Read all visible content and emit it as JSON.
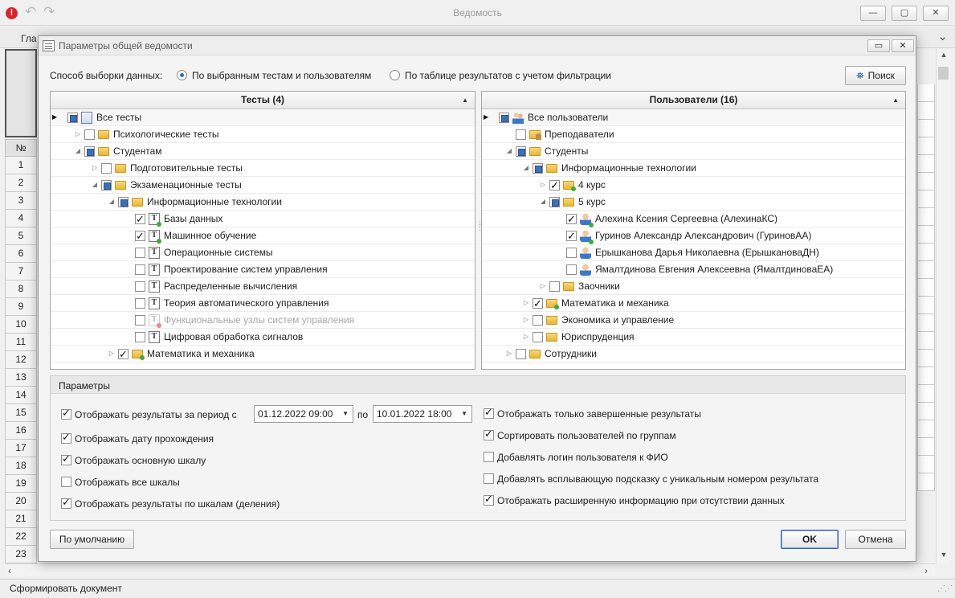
{
  "main": {
    "title": "Ведомость",
    "menu_tab": "Гла",
    "status": "Сформировать документ",
    "grid_header": "№",
    "row_numbers": [
      "1",
      "2",
      "3",
      "4",
      "5",
      "6",
      "7",
      "8",
      "9",
      "10",
      "11",
      "12",
      "13",
      "14",
      "15",
      "16",
      "17",
      "18",
      "19",
      "20",
      "21",
      "22",
      "23"
    ]
  },
  "dialog": {
    "title": "Параметры общей ведомости",
    "selection_label": "Способ выборки данных:",
    "radio_selected": "По выбранным тестам и пользователям",
    "radio_other": "По таблице результатов с учетом фильтрации",
    "search_button": "Поиск",
    "default_button": "По умолчанию",
    "ok_button": "OK",
    "cancel_button": "Отмена"
  },
  "tests": {
    "header": "Тесты (4)",
    "rows": [
      {
        "label": "Все тесты",
        "level": 0,
        "exp": "",
        "cb": "partial",
        "icon": "doc",
        "marker": true
      },
      {
        "label": "Психологические тесты",
        "level": 1,
        "exp": "collapsed",
        "cb": "unchecked",
        "icon": "folder"
      },
      {
        "label": "Студентам",
        "level": 1,
        "exp": "expanded",
        "cb": "partial",
        "icon": "folder"
      },
      {
        "label": "Подготовительные тесты",
        "level": 2,
        "exp": "collapsed",
        "cb": "unchecked",
        "icon": "folder"
      },
      {
        "label": "Экзаменационные тесты",
        "level": 2,
        "exp": "expanded",
        "cb": "partial",
        "icon": "folder"
      },
      {
        "label": "Информационные технологии",
        "level": 3,
        "exp": "expanded",
        "cb": "partial",
        "icon": "folder"
      },
      {
        "label": "Базы данных",
        "level": 4,
        "exp": "",
        "cb": "checked",
        "icon": "test-green"
      },
      {
        "label": "Машинное обучение",
        "level": 4,
        "exp": "",
        "cb": "checked",
        "icon": "test-green"
      },
      {
        "label": "Операционные системы",
        "level": 4,
        "exp": "",
        "cb": "unchecked",
        "icon": "test"
      },
      {
        "label": "Проектирование систем управления",
        "level": 4,
        "exp": "",
        "cb": "unchecked",
        "icon": "test"
      },
      {
        "label": "Распределенные вычисления",
        "level": 4,
        "exp": "",
        "cb": "unchecked",
        "icon": "test"
      },
      {
        "label": "Теория автоматического управления",
        "level": 4,
        "exp": "",
        "cb": "unchecked",
        "icon": "test"
      },
      {
        "label": "Функциональные узлы систем управления",
        "level": 4,
        "exp": "",
        "cb": "unchecked",
        "icon": "test-disabled",
        "disabled": true
      },
      {
        "label": "Цифровая обработка сигналов",
        "level": 4,
        "exp": "",
        "cb": "unchecked",
        "icon": "test"
      },
      {
        "label": "Математика и механика",
        "level": 3,
        "exp": "collapsed",
        "cb": "checked",
        "icon": "folder-green"
      }
    ]
  },
  "users": {
    "header": "Пользователи (16)",
    "rows": [
      {
        "label": "Все пользователи",
        "level": 0,
        "exp": "",
        "cb": "partial",
        "icon": "users",
        "marker": true
      },
      {
        "label": "Преподаватели",
        "level": 1,
        "exp": "",
        "cb": "unchecked",
        "icon": "teacher"
      },
      {
        "label": "Студенты",
        "level": 1,
        "exp": "expanded",
        "cb": "partial",
        "icon": "folder"
      },
      {
        "label": "Информационные технологии",
        "level": 2,
        "exp": "expanded",
        "cb": "partial",
        "icon": "folder"
      },
      {
        "label": "4 курс",
        "level": 3,
        "exp": "collapsed",
        "cb": "checked",
        "icon": "folder-green"
      },
      {
        "label": "5 курс",
        "level": 3,
        "exp": "expanded",
        "cb": "partial",
        "icon": "folder"
      },
      {
        "label": "Алехина Ксения Сергеевна (АлехинаКС)",
        "level": 4,
        "exp": "",
        "cb": "checked",
        "icon": "user-green"
      },
      {
        "label": "Гуринов Александр Александрович (ГуриновАА)",
        "level": 4,
        "exp": "",
        "cb": "checked",
        "icon": "user-green"
      },
      {
        "label": "Ерышканова Дарья Николаевна (ЕрышкановаДН)",
        "level": 4,
        "exp": "",
        "cb": "unchecked",
        "icon": "user"
      },
      {
        "label": "Ямалтдинова Евгения Алексеевна (ЯмалтдиноваЕА)",
        "level": 4,
        "exp": "",
        "cb": "unchecked",
        "icon": "user"
      },
      {
        "label": "Заочники",
        "level": 3,
        "exp": "collapsed",
        "cb": "unchecked",
        "icon": "folder"
      },
      {
        "label": "Математика и механика",
        "level": 2,
        "exp": "collapsed",
        "cb": "checked",
        "icon": "folder-green"
      },
      {
        "label": "Экономика и управление",
        "level": 2,
        "exp": "collapsed",
        "cb": "unchecked",
        "icon": "folder"
      },
      {
        "label": "Юриспруденция",
        "level": 2,
        "exp": "collapsed",
        "cb": "unchecked",
        "icon": "folder"
      },
      {
        "label": "Сотрудники",
        "level": 1,
        "exp": "collapsed",
        "cb": "unchecked",
        "icon": "folder"
      }
    ]
  },
  "params": {
    "title": "Параметры",
    "period_label": "Отображать результаты за период с",
    "period_checked": true,
    "date_from": "01.12.2022 09:00",
    "to_label": "по",
    "date_to": "10.01.2022 18:00",
    "left_options": [
      {
        "label": "Отображать дату прохождения",
        "checked": true
      },
      {
        "label": "Отображать основную шкалу",
        "checked": true
      },
      {
        "label": "Отображать все шкалы",
        "checked": false
      },
      {
        "label": "Отображать результаты по шкалам (деления)",
        "checked": true
      }
    ],
    "right_options": [
      {
        "label": "Отображать только завершенные результаты",
        "checked": true
      },
      {
        "label": "Сортировать пользователей по группам",
        "checked": true
      },
      {
        "label": "Добавлять логин пользователя к ФИО",
        "checked": false
      },
      {
        "label": "Добавлять всплывающую подсказку с уникальным номером результата",
        "checked": false
      },
      {
        "label": "Отображать расширенную информацию при отсутствии данных",
        "checked": true
      }
    ]
  }
}
